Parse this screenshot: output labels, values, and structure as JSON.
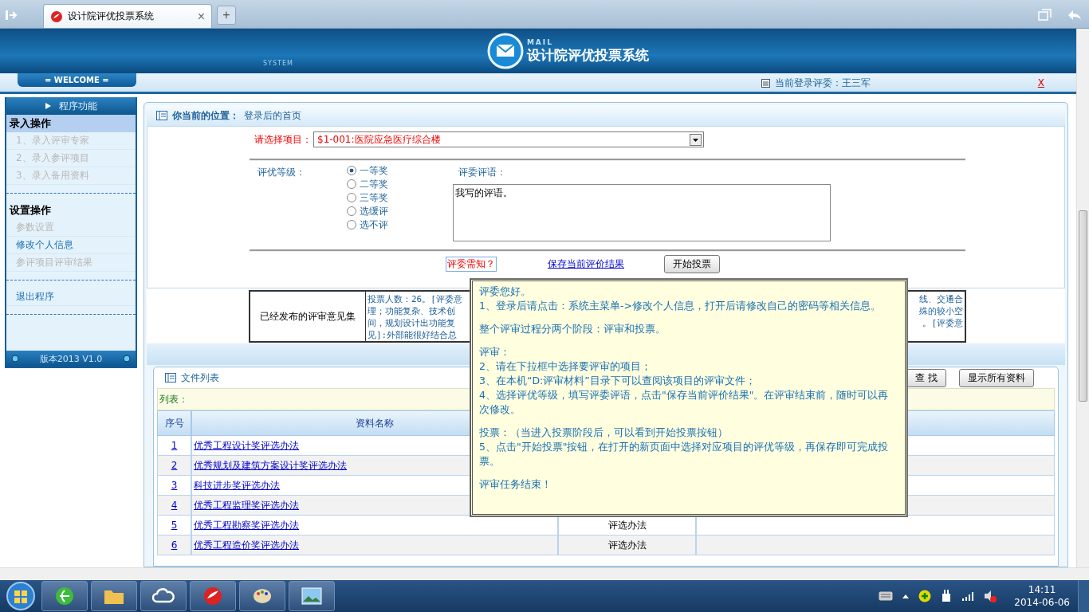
{
  "browser": {
    "tab_title": "设计院评优投票系统",
    "close": "×",
    "new_tab": "+"
  },
  "header": {
    "mail_label": "MAIL",
    "system_label": "SYSTEM",
    "title": "设计院评优投票系统",
    "welcome": "= WELCOME =",
    "user_label": "当前登录评委：王三军",
    "exit": "X"
  },
  "sidebar": {
    "title": "程序功能",
    "sections": [
      {
        "title": "录入操作",
        "selected": true,
        "items": [
          {
            "label": "1、录入评审专家",
            "disabled": true
          },
          {
            "label": "2、录入参评项目",
            "disabled": true
          },
          {
            "label": "3、录入备用资料",
            "disabled": true
          }
        ]
      },
      {
        "title": "设置操作",
        "selected": false,
        "items": [
          {
            "label": "参数设置",
            "disabled": true
          },
          {
            "label": "修改个人信息",
            "disabled": false
          },
          {
            "label": "参评项目评审结果",
            "disabled": true
          }
        ]
      },
      {
        "items": [
          {
            "label": "退出程序",
            "disabled": false
          }
        ]
      }
    ],
    "version": "版本2013 V1.0"
  },
  "breadcrumb": {
    "label": "你当前的位置：",
    "value": "登录后的首页"
  },
  "form": {
    "project_label": "请选择项目：",
    "project_value": "$1-001:医院应急医疗综合楼",
    "grade_label": "评优等级：",
    "grades": [
      {
        "label": "一等奖",
        "selected": true
      },
      {
        "label": "二等奖",
        "selected": false
      },
      {
        "label": "三等奖",
        "selected": false
      },
      {
        "label": "选缓评",
        "selected": false
      },
      {
        "label": "选不评",
        "selected": false
      }
    ],
    "comment_label": "评委评语：",
    "comment_value": "我写的评语。",
    "notice_link": "评委需知？",
    "save_link": "保存当前评价结果",
    "vote_button": "开始投票"
  },
  "opinions": {
    "label": "已经发布的评审意见集",
    "left_lines": [
      "投票人数：26。[评委意",
      "理；功能复杂、技术创",
      "间，规划设计出功能复",
      "见]:外部能很好结合总"
    ],
    "right_lines": [
      "线、交通合",
      "殊的较小空",
      "。[评委意"
    ]
  },
  "file_list": {
    "title": "文件列表",
    "search_button": "查 找",
    "show_all_button": "显示所有资料",
    "list_label": "列表：",
    "columns": [
      "序号",
      "资料名称"
    ],
    "rows": [
      {
        "index": "1",
        "name": "优秀工程设计奖评选办法"
      },
      {
        "index": "2",
        "name": "优秀规划及建筑方案设计奖评选办法"
      },
      {
        "index": "3",
        "name": "科技进步奖评选办法"
      },
      {
        "index": "4",
        "name": "优秀工程监理奖评选办法"
      },
      {
        "index": "5",
        "name": "优秀工程勘察奖评选办法",
        "column_3": "评选办法"
      },
      {
        "index": "6",
        "name": "优秀工程造价奖评选办法",
        "column_3": "评选办法"
      }
    ]
  },
  "notice": {
    "paragraphs": [
      [
        "评委您好。",
        "1、登录后请点击：系统主菜单->修改个人信息，打开后请修改自己的密码等相关信息。"
      ],
      [
        "整个评审过程分两个阶段：评审和投票。"
      ],
      [
        "评审：",
        "2、请在下拉框中选择要评审的项目；",
        "3、在本机“D:评审材料”目录下可以查阅该项目的评审文件；",
        "4、选择评优等级，填写评委评语，点击\"保存当前评价结果\"。在评审结束前，随时可以再次修改。"
      ],
      [
        "投票：（当进入投票阶段后，可以看到开始投票按钮）",
        "5、点击\"开始投票\"按钮，在打开的新页面中选择对应项目的评优等级，再保存即可完成投票。"
      ],
      [
        "评审任务结束！"
      ]
    ]
  },
  "taskbar": {
    "time": "14:11",
    "date": "2014-06-06"
  }
}
